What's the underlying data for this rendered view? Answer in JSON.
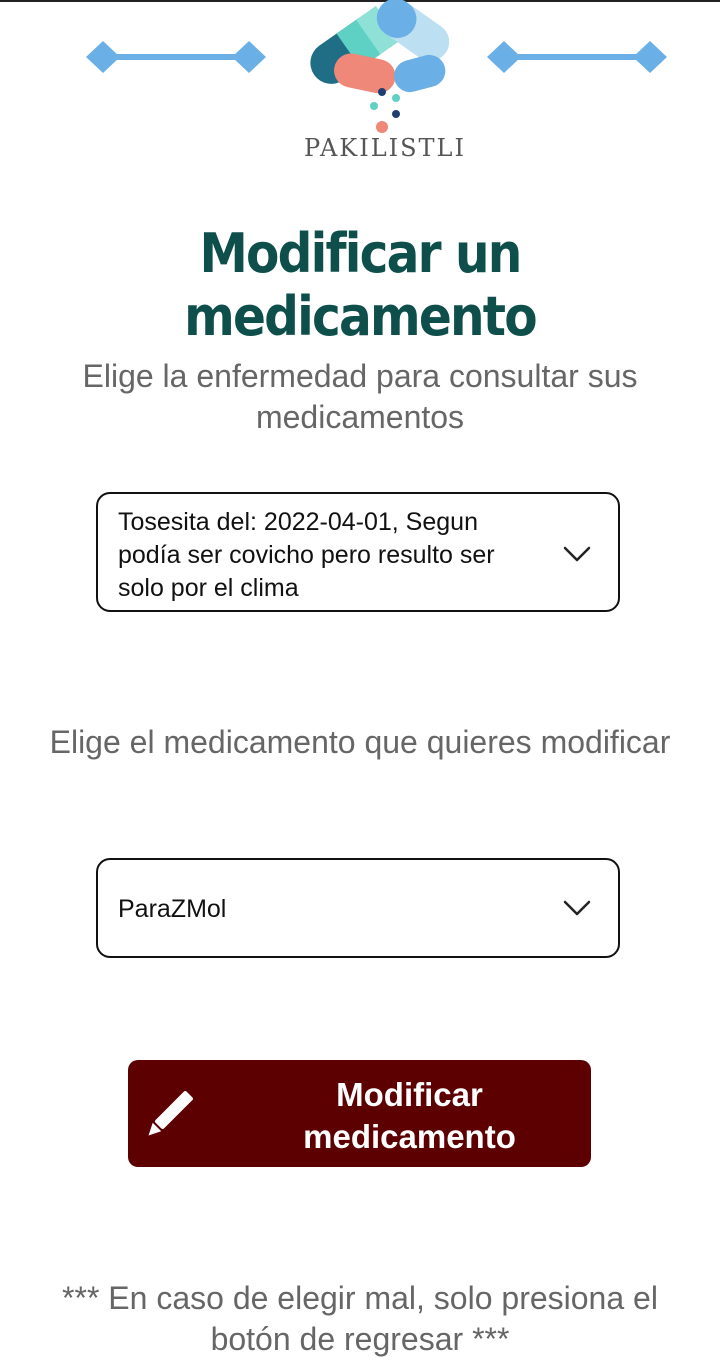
{
  "app": {
    "logo_text": "PAKILISTLI"
  },
  "page": {
    "title": "Modificar un medicamento"
  },
  "illness_section": {
    "prompt": "Elige la enfermedad para consultar sus medicamentos",
    "selected": "Tosesita del: 2022-04-01, Segun podía ser covicho pero resulto ser solo por el clima"
  },
  "medication_section": {
    "prompt": "Elige el medicamento que quieres modificar",
    "selected": "ParaZMol"
  },
  "action": {
    "label": "Modificar medicamento"
  },
  "footer": {
    "note": "*** En caso de elegir mal, solo presiona el botón de regresar ***"
  },
  "colors": {
    "title": "#0f4f4b",
    "button_bg": "#5c0002",
    "prompt_text": "#666666",
    "deco_blue": "#6aafe6"
  },
  "icons": {
    "dropdown": "chevron-down-icon",
    "edit": "pencil-icon",
    "logo": "pills-logo"
  }
}
